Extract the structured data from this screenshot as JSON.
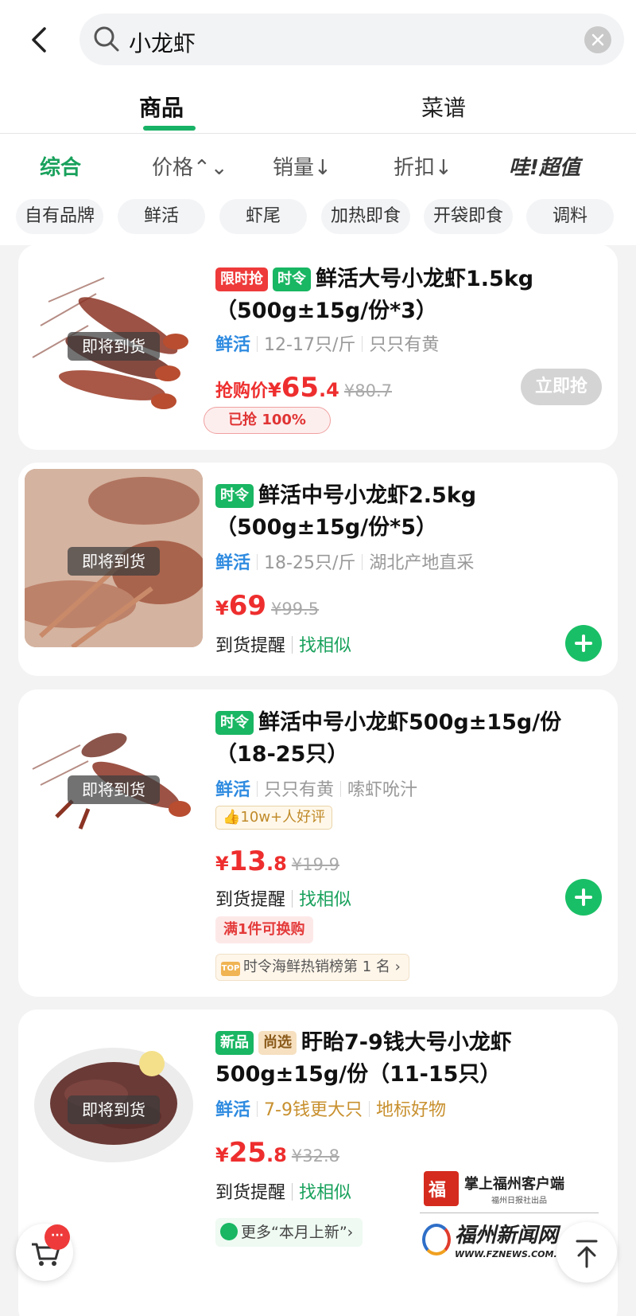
{
  "search": {
    "query": "小龙虾"
  },
  "tabs": [
    {
      "label": "商品",
      "active": true
    },
    {
      "label": "菜谱",
      "active": false
    }
  ],
  "sorts": [
    {
      "label": "综合",
      "active": true
    },
    {
      "label": "价格⌃⌄"
    },
    {
      "label": "销量↓"
    },
    {
      "label": "折扣↓"
    },
    {
      "label": "哇!超值"
    }
  ],
  "chips": [
    "自有品牌",
    "鲜活",
    "虾尾",
    "加热即食",
    "开袋即食",
    "调料"
  ],
  "colors": {
    "accent": "#19a15c",
    "price": "#ee2e2e",
    "attr_blue": "#2f8be0"
  },
  "products": [
    {
      "tags": [
        "限时抢",
        "时令"
      ],
      "title": "鲜活大号小龙虾1.5kg（500g±15g/份*3）",
      "badge": "即将到货",
      "attr_main": "鲜活",
      "attrs": [
        "12-17只/斤",
        "只只有黄"
      ],
      "price_prefix": "抢购价",
      "currency": "¥",
      "price_int": "65",
      "price_dec": ".4",
      "orig_price": "¥80.7",
      "sold_label": "已抢 100%",
      "grab_label": "立即抢"
    },
    {
      "tags": [
        "时令"
      ],
      "title": "鲜活中号小龙虾2.5kg（500g±15g/份*5）",
      "badge": "即将到货",
      "attr_main": "鲜活",
      "attrs": [
        "18-25只/斤",
        "湖北产地直采"
      ],
      "currency": "¥",
      "price_int": "69",
      "price_dec": "",
      "orig_price": "¥99.5",
      "remind": "到货提醒",
      "similar": "找相似"
    },
    {
      "tags": [
        "时令"
      ],
      "title": "鲜活中号小龙虾500g±15g/份（18-25只）",
      "badge": "即将到货",
      "attr_main": "鲜活",
      "attrs": [
        "只只有黄",
        "嗦虾吮汁"
      ],
      "review": "10w+人好评",
      "currency": "¥",
      "price_int": "13",
      "price_dec": ".8",
      "orig_price": "¥19.9",
      "remind": "到货提醒",
      "similar": "找相似",
      "promo": "满1件可换购",
      "rank_icon": "TOP",
      "rank": "时令海鲜热销榜第 1 名 ›"
    },
    {
      "tags": [
        "新品",
        "尚选"
      ],
      "title": "盱眙7-9钱大号小龙虾500g±15g/份（11-15只）",
      "badge": "即将到货",
      "attr_main": "鲜活",
      "attrs": [
        "7-9钱更大只",
        "地标好物"
      ],
      "currency": "¥",
      "price_int": "25",
      "price_dec": ".8",
      "orig_price": "¥32.8",
      "remind": "到货提醒",
      "similar": "找相似",
      "more": "更多“本月上新”›"
    }
  ],
  "cart": {
    "badge": "···"
  },
  "watermark": {
    "logo_text": "福",
    "line1": "掌上福州客户端",
    "line2": "福州日报社出品",
    "line3": "福州新闻网",
    "line4": "WWW.FZNEWS.COM.CN"
  }
}
